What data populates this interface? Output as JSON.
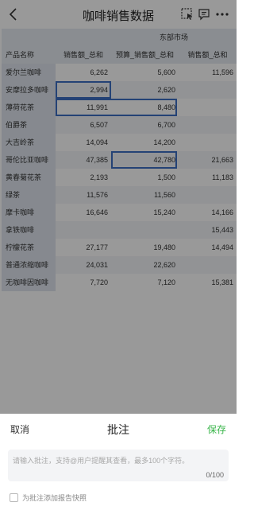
{
  "header": {
    "title": "咖啡销售数据",
    "icons": [
      "back-icon",
      "select-area-icon",
      "comment-icon",
      "more-icon"
    ]
  },
  "table": {
    "group_header": "东部市场",
    "row_header_label": "产品名称",
    "columns": [
      "销售额_总和",
      "预算_销售额_总和",
      "销售额_总和"
    ],
    "rows": [
      {
        "name": "爱尔兰咖啡",
        "v1": "6,262",
        "v2": "5,600",
        "v3": "11,596"
      },
      {
        "name": "安摩拉多咖啡",
        "v1": "2,994",
        "v2": "2,620",
        "v3": ""
      },
      {
        "name": "薄荷花茶",
        "v1": "11,991",
        "v2": "8,480",
        "v3": ""
      },
      {
        "name": "伯爵茶",
        "v1": "6,507",
        "v2": "6,700",
        "v3": ""
      },
      {
        "name": "大吉岭茶",
        "v1": "14,094",
        "v2": "14,200",
        "v3": ""
      },
      {
        "name": "哥伦比亚咖啡",
        "v1": "47,385",
        "v2": "42,780",
        "v3": "21,663"
      },
      {
        "name": "黄春菊花茶",
        "v1": "2,193",
        "v2": "1,500",
        "v3": "11,183"
      },
      {
        "name": "绿茶",
        "v1": "11,576",
        "v2": "11,560",
        "v3": ""
      },
      {
        "name": "摩卡咖啡",
        "v1": "16,646",
        "v2": "15,240",
        "v3": "14,166"
      },
      {
        "name": "拿铁咖啡",
        "v1": "",
        "v2": "",
        "v3": "15,443"
      },
      {
        "name": "柠檬花茶",
        "v1": "27,177",
        "v2": "19,480",
        "v3": "14,494"
      },
      {
        "name": "普通浓缩咖啡",
        "v1": "24,031",
        "v2": "22,620",
        "v3": ""
      },
      {
        "name": "无咖啡因咖啡",
        "v1": "7,720",
        "v2": "7,120",
        "v3": "15,381"
      }
    ]
  },
  "sheet": {
    "cancel_label": "取消",
    "title": "批注",
    "save_label": "保存",
    "input_placeholder": "请输入批注，支持@用户提醒其查看，最多100个字符。",
    "input_value": "",
    "counter": "0/100",
    "checkbox_label": "为批注添加报告快照",
    "checkbox_checked": false
  },
  "colors": {
    "accent_green": "#39b54a",
    "selection_blue": "#3d6fc4",
    "overlay": "rgba(0,0,0,0.40)"
  }
}
